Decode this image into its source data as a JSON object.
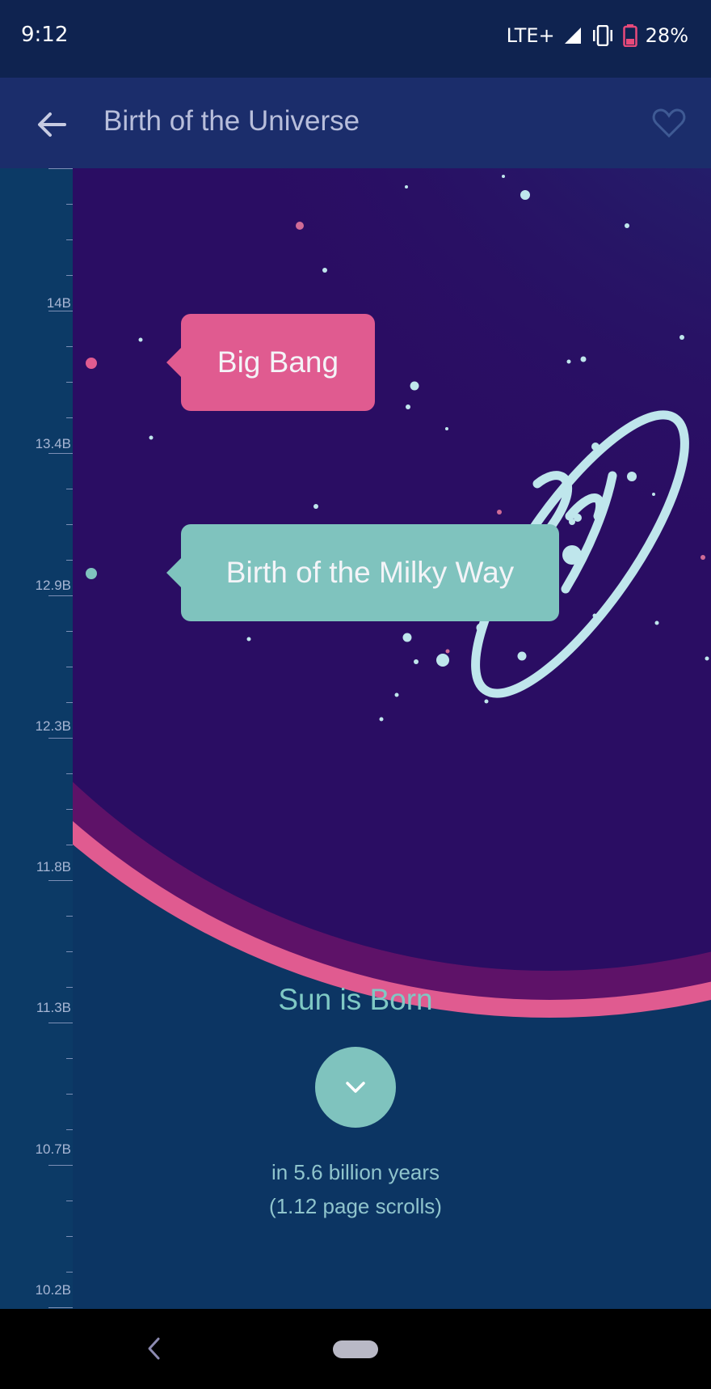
{
  "status_bar": {
    "time": "9:12",
    "network": "LTE+",
    "battery": "28%",
    "icons": [
      "signal-icon",
      "vibrate-icon",
      "battery-icon"
    ]
  },
  "app_bar": {
    "title": "Birth of the Universe",
    "back_icon": "arrow-left-icon",
    "favorite_icon": "heart-outline-icon"
  },
  "timeline": {
    "labels": [
      "14B",
      "13.4B",
      "12.9B",
      "12.3B",
      "11.8B",
      "11.3B",
      "10.7B",
      "10.2B"
    ]
  },
  "events": [
    {
      "label": "Big Bang",
      "color": "#e05b90"
    },
    {
      "label": "Birth of the Milky Way",
      "color": "#7fc3be"
    }
  ],
  "next_event": {
    "title": "Sun is Born",
    "line1": "in 5.6 billion years",
    "line2": "(1.12 page scrolls)",
    "button_icon": "chevron-down-icon"
  },
  "colors": {
    "background": "#0c3563",
    "accent_pink": "#e05b90",
    "accent_teal": "#7fc3be",
    "space": "#2a0d63"
  },
  "nav_bar": {
    "back_icon": "nav-back-icon",
    "home_icon": "home-pill-icon"
  }
}
